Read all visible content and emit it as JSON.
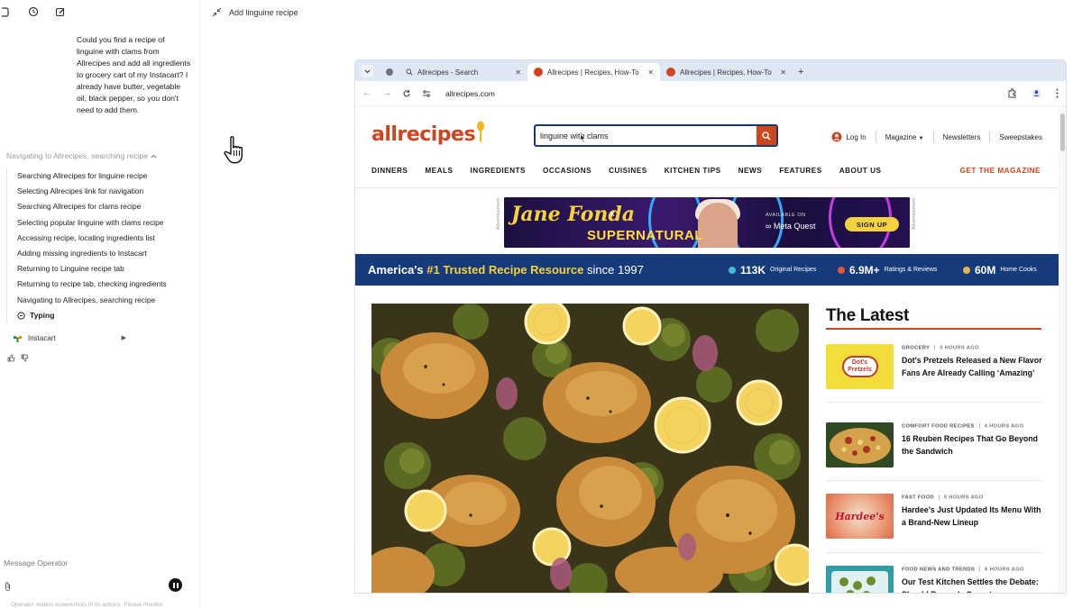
{
  "operator": {
    "user_message": "Could you find a recipe of linguine with clams from Allrecipes and add all ingredients to grocery cart of my Instacart? I already have butter, vegetable oil, black pepper, so you don't need to add them.",
    "progress_header": "Navigating to Allrecipes, searching recipe",
    "steps": [
      "Searching Allrecipes for linguine recipe",
      "Selecting Allrecipes link for navigation",
      "Searching Allrecipes for clams recipe",
      "Selecting popular linguine with clams recipe",
      "Accessing recipe, locating ingredients list",
      "Adding missing ingredients to Instacart",
      "Returning to Linguine recipe tab",
      "Returning to recipe tab, checking ingredients",
      "Navigating to Allrecipes, searching recipe"
    ],
    "current_action": "Typing",
    "app_label": "Instacart",
    "message_placeholder": "Message Operator",
    "footnote": "Operator retains screenshots of its actions. Please monitor"
  },
  "task_title": "Add linguine recipe",
  "browser": {
    "tabs": [
      {
        "title": "Allrecipes - Search",
        "active": false
      },
      {
        "title": "Allrecipes | Recipes, How-To",
        "active": true
      },
      {
        "title": "Allrecipes | Recipes, How-To",
        "active": false
      }
    ],
    "url": "allrecipes.com"
  },
  "site": {
    "logo": "allrecipes",
    "search_value": "linguine with clams",
    "login": "Log In",
    "magazine": "Magazine",
    "newsletters": "Newsletters",
    "sweepstakes": "Sweepstakes",
    "nav": [
      "DINNERS",
      "MEALS",
      "INGREDIENTS",
      "OCCASIONS",
      "CUISINES",
      "KITCHEN TIPS",
      "NEWS",
      "FEATURES",
      "ABOUT US"
    ],
    "get_magazine": "GET THE MAGAZINE",
    "ad": {
      "label": "Advertisement",
      "line1": "Jane Fonda",
      "x": "x",
      "line2": "SUPERNATURAL",
      "available": "AVAILABLE ON",
      "platform": "Meta Quest",
      "cta": "SIGN UP"
    },
    "banner": {
      "prefix": "America's ",
      "highlight": "#1 Trusted Recipe Resource",
      "suffix": " since 1997",
      "stats": [
        {
          "num": "113K",
          "label": "Original Recipes",
          "color": "#47b8d6"
        },
        {
          "num": "6.9M+",
          "label": "Ratings & Reviews",
          "color": "#e8533a"
        },
        {
          "num": "60M",
          "label": "Home Cooks",
          "color": "#e3b84c"
        }
      ]
    },
    "latest": {
      "title": "The Latest",
      "items": [
        {
          "category": "GROCERY",
          "time": "3 HOURS AGO",
          "headline": "Dot's Pretzels Released a New Flavor Fans Are Already Calling ‘Amazing’",
          "thumb_text": "Dot's Pretzels"
        },
        {
          "category": "COMFORT FOOD RECIPES",
          "time": "4 HOURS AGO",
          "headline": "16 Reuben Recipes That Go Beyond the Sandwich",
          "thumb_text": ""
        },
        {
          "category": "FAST FOOD",
          "time": "5 HOURS AGO",
          "headline": "Hardee's Just Updated Its Menu With a Brand-New Lineup",
          "thumb_text": "Hardee's"
        },
        {
          "category": "FOOD NEWS AND TRENDS",
          "time": "6 HOURS AGO",
          "headline": "Our Test Kitchen Settles the Debate: Should Brussels Sprouts",
          "thumb_text": ""
        }
      ]
    }
  },
  "colors": {
    "brand": "#ce4620",
    "banner": "#163a7a",
    "tabbar": "#dfe7f5"
  }
}
